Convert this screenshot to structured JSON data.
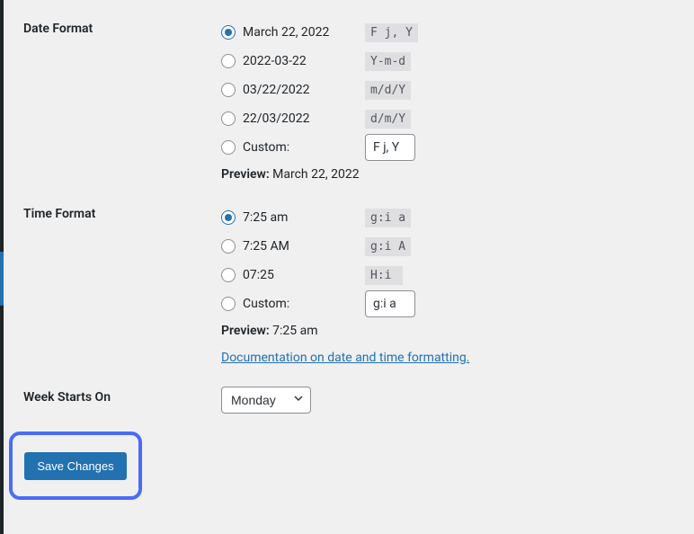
{
  "date_format": {
    "heading": "Date Format",
    "options": [
      {
        "label": "March 22, 2022",
        "code": "F j, Y",
        "checked": true
      },
      {
        "label": "2022-03-22",
        "code": "Y-m-d",
        "checked": false
      },
      {
        "label": "03/22/2022",
        "code": "m/d/Y",
        "checked": false
      },
      {
        "label": "22/03/2022",
        "code": "d/m/Y",
        "checked": false
      }
    ],
    "custom_label": "Custom:",
    "custom_value": "F j, Y",
    "preview_label": "Preview:",
    "preview_value": "March 22, 2022"
  },
  "time_format": {
    "heading": "Time Format",
    "options": [
      {
        "label": "7:25 am",
        "code": "g:i a",
        "checked": true
      },
      {
        "label": "7:25 AM",
        "code": "g:i A",
        "checked": false
      },
      {
        "label": "07:25",
        "code": "H:i",
        "checked": false
      }
    ],
    "custom_label": "Custom:",
    "custom_value": "g:i a",
    "preview_label": "Preview:",
    "preview_value": "7:25 am",
    "doc_link": "Documentation on date and time formatting"
  },
  "week_starts": {
    "heading": "Week Starts On",
    "selected": "Monday"
  },
  "save_button": "Save Changes"
}
